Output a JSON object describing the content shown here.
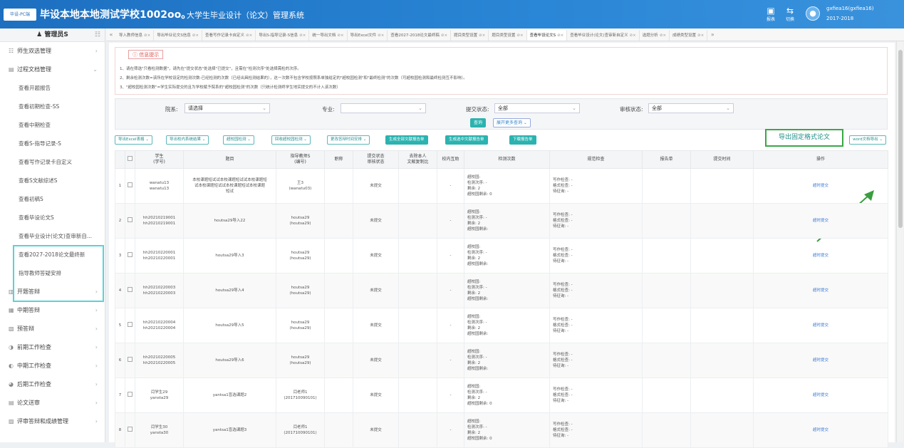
{
  "app": {
    "logo_text": "毕设-PC端",
    "title": "毕设本地本地测试学校1002oo。",
    "subtitle": "大学生毕业设计（论文）管理系统",
    "report_label": "报表",
    "switch_label": "切换",
    "user_name": "gxfiea16(gxfiea16)",
    "user_year": "2017-2018"
  },
  "sidebar": {
    "header": "管理员S",
    "groups_top": [
      {
        "label": "师生双选管理"
      },
      {
        "label": "过程文档管理"
      }
    ],
    "sub_items": [
      "查看开题报告",
      "查看初期检查-SS",
      "查看中期检查",
      "查看S-指导记录-S",
      "查看写作记录卡自定义",
      "查看S文献综述S",
      "查看初稿S",
      "查看毕设论文S",
      "查看毕业设计(论文)查审新自...",
      "查看2027-2018论文最终新",
      "指导教师答疑安排"
    ],
    "groups_bottom": [
      {
        "label": "开题答辩"
      },
      {
        "label": "中期答辩"
      },
      {
        "label": "预答辩"
      },
      {
        "label": "前期工作检查"
      },
      {
        "label": "中期工作检查"
      },
      {
        "label": "后期工作检查"
      },
      {
        "label": "论文送审"
      },
      {
        "label": "评审答辩和成绩管理"
      }
    ]
  },
  "tabs": [
    "导入教师信息",
    "导出毕业论文S信息",
    "查看写作记录卡自定义",
    "导出S-指导记录-S信息",
    "统一导出文档",
    "导出Excel文件",
    "查看2027-2018论文最终稿",
    "题目类型设置",
    "题目类型设置",
    "查看毕设论文S",
    "查看毕业设计(论文)查审新自定义",
    "选题分析",
    "成绩类型设置"
  ],
  "active_tab_index": 9,
  "notice": {
    "tag": "信息提示",
    "lines": [
      "1、请在筛选\"只看检测数据\"，请先在\"提交状态\"处选择\"已提交\"，且需在\"检测次序\"处选择需检的次序。",
      "2、剩余检测次数=该所在学校设定的检测次数-已经检测的次数（已经出具检测结果的），这一次数不包含学校按照系单独给定的\"超校园检测\"和\"最终检测\"的次数（可超校园检测和最终检测互不影响）。",
      "3、\"超校园检测次数\"=学生实际提交的且为学校赋予院系的\"超校园检测\"的次数（只统计检测终学生地实提交的不计入该次数）"
    ]
  },
  "filters": {
    "department_label": "院系:",
    "department_value": "请选择",
    "major_label": "专业:",
    "major_value": "",
    "submit_label": "提交状态:",
    "submit_value": "全部",
    "review_label": "审核状态:",
    "review_value": "全部",
    "query_btn": "查询",
    "more_btn": "展开更多查询"
  },
  "actions": {
    "buttons": [
      {
        "label": "导出Excel表格",
        "style": "o"
      },
      {
        "label": "导出校内系统结果",
        "style": "o"
      },
      {
        "label": "超校园检测",
        "style": "o"
      },
      {
        "label": "回收超校园检测",
        "style": "o"
      },
      {
        "label": "更改答辩时间安排",
        "style": "o"
      },
      {
        "label": "生成全部文献报告单",
        "style": "f"
      },
      {
        "label": "生成选中文献报告单",
        "style": "f"
      },
      {
        "label": "下载报告单",
        "style": "f"
      }
    ],
    "export_fixed": "导出固定格式论文",
    "word_export": "word文档导出"
  },
  "table": {
    "headers": {
      "student": "学生\n(学号)",
      "title": "题目",
      "teacher": "指导教师S\n(编号)",
      "rank": "职称",
      "submit_status": "提交状态\n审核状态",
      "plag_rate": "去除本人\n文献复制比",
      "campus": "校内互助",
      "check_count": "检测次数",
      "format_check": "规范检查",
      "report": "报告单",
      "submit_time": "提交时间",
      "ops": "操作"
    },
    "check_labels": [
      "超校园:",
      "检测次序: -",
      "剩余: 2",
      "超校园剩余:"
    ],
    "format_labels": [
      "写作检查: -",
      "格式检查: -",
      "待征询: -"
    ],
    "rows": [
      {
        "no": "1",
        "student": "wanatu13\nwanatu13",
        "title": "本校课题短试试本校课题短试试本校课题短\n试本校课题短试试本校课题短试本校课题\n短试",
        "teacher": "王3\n(wanatu03)",
        "status": "未提交",
        "rate": "-",
        "left4": "超校园剩余: 0",
        "op": "超时提交"
      },
      {
        "no": "2",
        "student": "hh20210219001\nhh20210219001",
        "title": "houtsa29导入22",
        "teacher": "houtsa29\n(houtsa29)",
        "status": "未提交",
        "rate": "-",
        "left4": "超校园剩余:",
        "op": "超时提交"
      },
      {
        "no": "3",
        "student": "hh20210220001\nhh20210220001",
        "title": "houtsa29导入3",
        "teacher": "houtsa29\n(houtsa29)",
        "status": "未提交",
        "rate": "-",
        "left4": "超校园剩余:",
        "op": "超时提交"
      },
      {
        "no": "4",
        "student": "hh20210220003\nhh20210220003",
        "title": "houtsa29导入4",
        "teacher": "houtsa29\n(houtsa29)",
        "status": "未提交",
        "rate": "-",
        "left4": "超校园剩余:",
        "op": "超时提交"
      },
      {
        "no": "5",
        "student": "hh20210220004\nhh20210220004",
        "title": "houtsa29导入5",
        "teacher": "houtsa29\n(houtsa29)",
        "status": "未提交",
        "rate": "-",
        "left4": "超校园剩余:",
        "op": "超时提交"
      },
      {
        "no": "6",
        "student": "hh20210220005\nhh20210220005",
        "title": "houtsa29导入6",
        "teacher": "houtsa29\n(houtsa29)",
        "status": "未提交",
        "rate": "-",
        "left4": "超校园剩余:",
        "op": "超时提交"
      },
      {
        "no": "7",
        "student": "闫学生29\nyansta29",
        "title": "yantsa1盲选课题2",
        "teacher": "闫老师1\n(201710090101)",
        "status": "未提交",
        "rate": "-",
        "left4": "超校园剩余: 0",
        "op": "超时提交"
      },
      {
        "no": "8",
        "student": "闫学生30\nyansta30",
        "title": "yantsa1盲选课题3",
        "teacher": "闫老师1\n(201710090101)",
        "status": "未提交",
        "rate": "-",
        "left4": "超校园剩余: 0",
        "op": "超时提交"
      }
    ]
  }
}
